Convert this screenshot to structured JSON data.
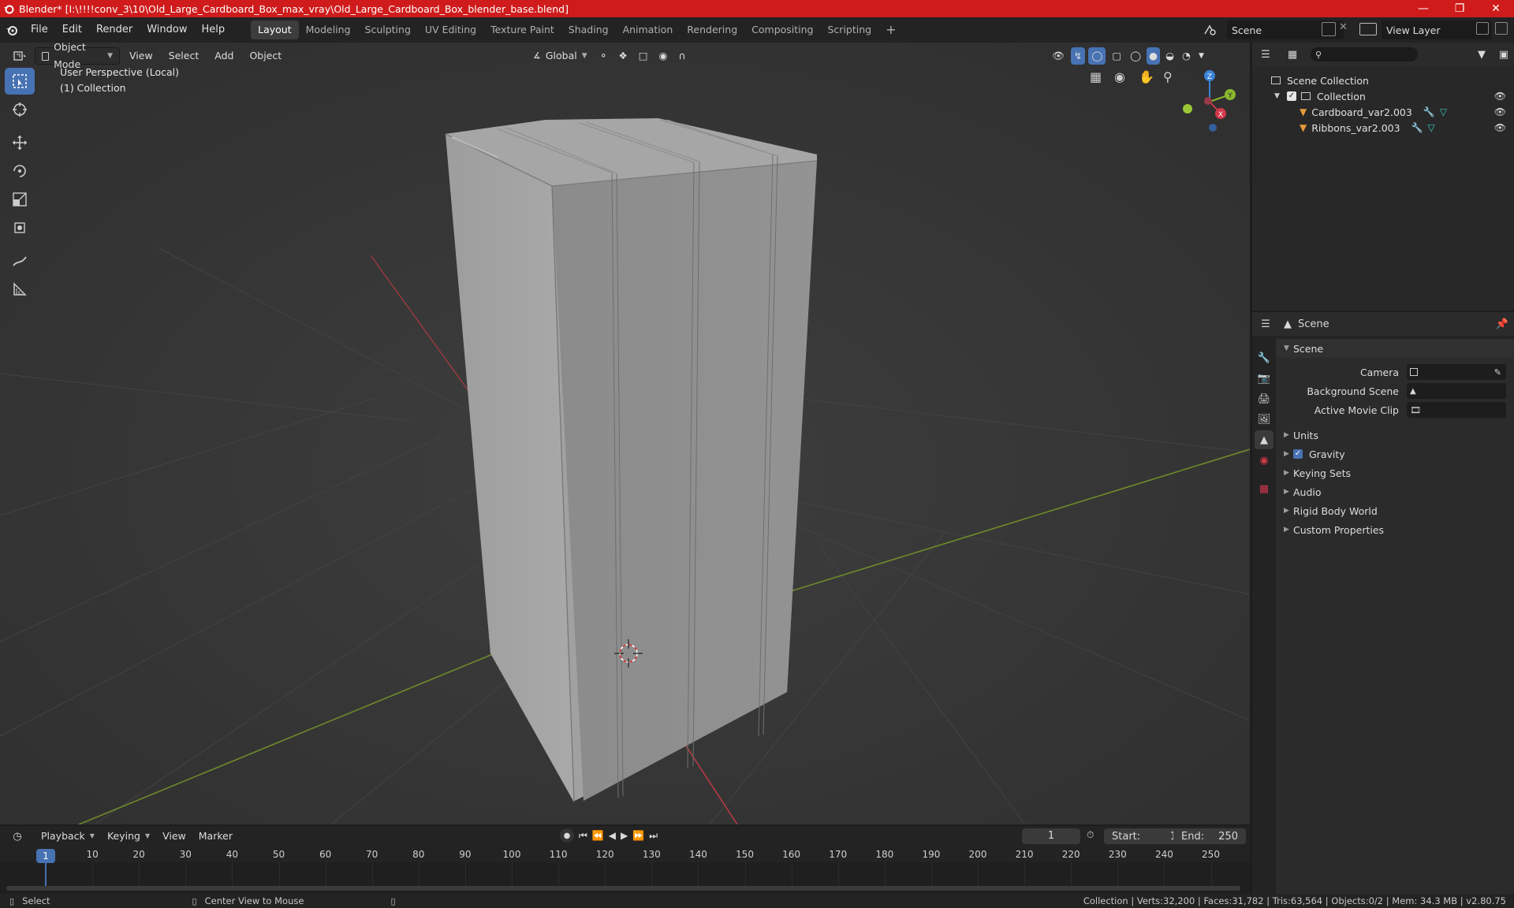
{
  "window": {
    "title": "Blender* [I:\\!!!!conv_3\\10\\Old_Large_Cardboard_Box_max_vray\\Old_Large_Cardboard_Box_blender_base.blend]"
  },
  "menu": [
    "File",
    "Edit",
    "Render",
    "Window",
    "Help"
  ],
  "workspaces": [
    {
      "label": "Layout",
      "active": true
    },
    {
      "label": "Modeling"
    },
    {
      "label": "Sculpting"
    },
    {
      "label": "UV Editing"
    },
    {
      "label": "Texture Paint"
    },
    {
      "label": "Shading"
    },
    {
      "label": "Animation"
    },
    {
      "label": "Rendering"
    },
    {
      "label": "Compositing"
    },
    {
      "label": "Scripting"
    }
  ],
  "scene_name": "Scene",
  "view_layer": "View Layer",
  "viewport": {
    "mode": "Object Mode",
    "menus": [
      "View",
      "Select",
      "Add",
      "Object"
    ],
    "transform_orientation": "Global",
    "perspective_label": "User Perspective (Local)",
    "collection_label": "(1) Collection",
    "gizmo_axes": {
      "x": "X",
      "y": "Y",
      "z": "Z"
    }
  },
  "outliner": {
    "root": "Scene Collection",
    "collection": "Collection",
    "objects": [
      "Cardboard_var2.003",
      "Ribbons_var2.003"
    ]
  },
  "properties": {
    "context": "Scene",
    "section": "Scene",
    "fields": [
      {
        "label": "Camera",
        "value": ""
      },
      {
        "label": "Background Scene",
        "value": ""
      },
      {
        "label": "Active Movie Clip",
        "value": ""
      }
    ],
    "panels": [
      {
        "label": "Units",
        "checkbox": false
      },
      {
        "label": "Gravity",
        "checkbox": true
      },
      {
        "label": "Keying Sets",
        "checkbox": false
      },
      {
        "label": "Audio",
        "checkbox": false
      },
      {
        "label": "Rigid Body World",
        "checkbox": false
      },
      {
        "label": "Custom Properties",
        "checkbox": false
      }
    ]
  },
  "timeline": {
    "menus": [
      "Playback",
      "Keying",
      "View",
      "Marker"
    ],
    "current_frame": "1",
    "start_label": "Start:",
    "start": "1",
    "end_label": "End:",
    "end": "250",
    "ticks": [
      "10",
      "20",
      "30",
      "40",
      "50",
      "60",
      "70",
      "80",
      "90",
      "100",
      "110",
      "120",
      "130",
      "140",
      "150",
      "160",
      "170",
      "180",
      "190",
      "200",
      "210",
      "220",
      "230",
      "240",
      "250"
    ]
  },
  "statusbar": {
    "left1": "Select",
    "left2": "Center View to Mouse",
    "right": "Collection | Verts:32,200 | Faces:31,782 | Tris:63,564 | Objects:0/2 | Mem: 34.3 MB | v2.80.75"
  },
  "colors": {
    "titlebar": "#cf1b1b",
    "accent": "#4772b3",
    "x_axis": "#d0384a",
    "y_axis": "#8ab82e",
    "z_axis": "#3a83d6"
  }
}
